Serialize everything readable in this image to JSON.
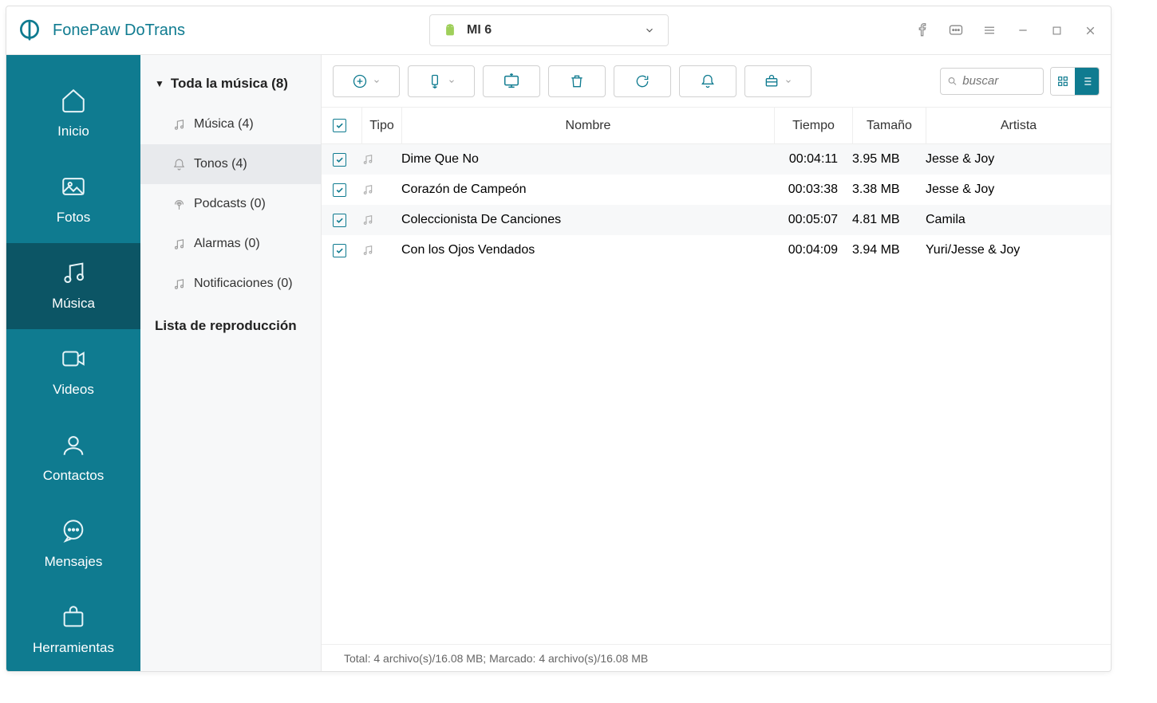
{
  "app": {
    "title": "FonePaw DoTrans"
  },
  "device": {
    "name": "MI 6"
  },
  "sidebar": {
    "items": [
      {
        "label": "Inicio"
      },
      {
        "label": "Fotos"
      },
      {
        "label": "Música"
      },
      {
        "label": "Videos"
      },
      {
        "label": "Contactos"
      },
      {
        "label": "Mensajes"
      },
      {
        "label": "Herramientas"
      }
    ]
  },
  "categories": {
    "header": "Toda la música (8)",
    "items": [
      {
        "label": "Música (4)"
      },
      {
        "label": "Tonos (4)"
      },
      {
        "label": "Podcasts (0)"
      },
      {
        "label": "Alarmas (0)"
      },
      {
        "label": "Notificaciones (0)"
      }
    ],
    "playlist_header": "Lista de reproducción"
  },
  "search": {
    "placeholder": "buscar"
  },
  "table": {
    "headers": {
      "type": "Tipo",
      "name": "Nombre",
      "time": "Tiempo",
      "size": "Tamaño",
      "artist": "Artista"
    },
    "rows": [
      {
        "name": "Dime Que No",
        "time": "00:04:11",
        "size": "3.95 MB",
        "artist": "Jesse & Joy"
      },
      {
        "name": "Corazón de Campeón",
        "time": "00:03:38",
        "size": "3.38 MB",
        "artist": "Jesse & Joy"
      },
      {
        "name": "Coleccionista De Canciones",
        "time": "00:05:07",
        "size": "4.81 MB",
        "artist": "Camila"
      },
      {
        "name": "Con los Ojos Vendados",
        "time": "00:04:09",
        "size": "3.94 MB",
        "artist": "Yuri/Jesse & Joy"
      }
    ]
  },
  "status": {
    "text": "Total: 4 archivo(s)/16.08 MB; Marcado: 4 archivo(s)/16.08 MB"
  }
}
